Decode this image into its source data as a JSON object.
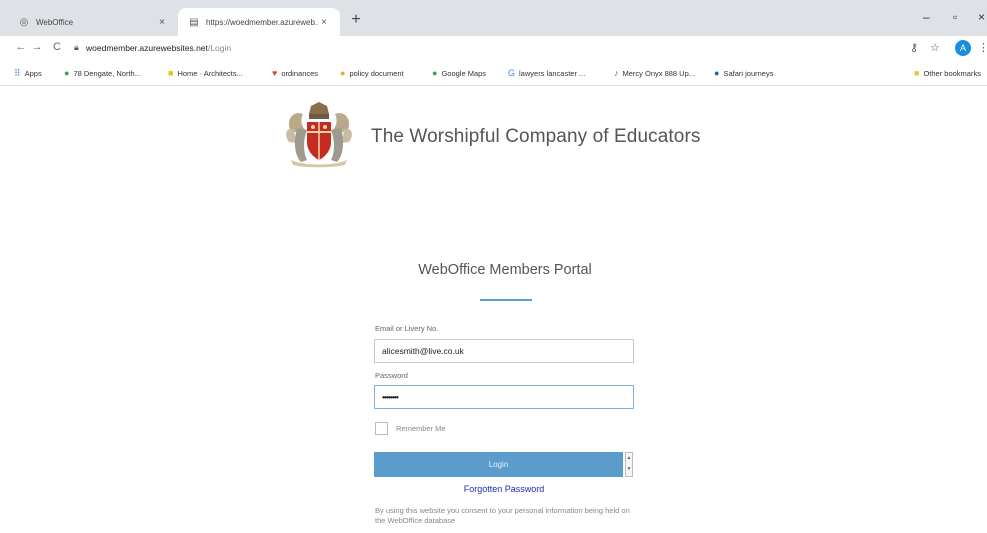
{
  "browser": {
    "tabs": [
      {
        "title": "WebOffice",
        "close": "×"
      },
      {
        "title": "https://woedmember.azureweb...",
        "close": "×"
      }
    ],
    "new_tab": "+",
    "window": {
      "minimize": "–",
      "maximize": "▫",
      "close": "×"
    },
    "nav": {
      "back": "←",
      "forward": "→",
      "reload": "C"
    },
    "address": {
      "host": "woedmember.azurewebsites.net",
      "path": "/Login"
    },
    "profile_initial": "A",
    "bookmarks": [
      {
        "label": "Apps",
        "icon": "apps-grid-icon",
        "glyph": "⠿",
        "color": "#4a7fd0"
      },
      {
        "label": "78 Dengate, North...",
        "icon": "maps-pin-icon",
        "glyph": "●",
        "color": "#34a853"
      },
      {
        "label": "Home · Architects...",
        "icon": "architects-icon",
        "glyph": "■",
        "color": "#e6c21a"
      },
      {
        "label": "ordinances",
        "icon": "heart-icon",
        "glyph": "♥",
        "color": "#d84a2a"
      },
      {
        "label": "policy document",
        "icon": "policy-icon",
        "glyph": "●",
        "color": "#f2a62a"
      },
      {
        "label": "Google Maps",
        "icon": "maps-pin-icon",
        "glyph": "●",
        "color": "#34a853"
      },
      {
        "label": "lawyers lancaster ...",
        "icon": "google-icon",
        "glyph": "G",
        "color": "#4285f4"
      },
      {
        "label": "Mercy Onyx 888 Up...",
        "icon": "mercy-icon",
        "glyph": "♪",
        "color": "#7a4bbf"
      },
      {
        "label": "Safari journeys",
        "icon": "safari-icon",
        "glyph": "●",
        "color": "#2a5fb0"
      },
      {
        "label": "Other bookmarks",
        "icon": "folder-icon",
        "glyph": "■",
        "color": "#f0c24a"
      }
    ]
  },
  "page": {
    "org_name": "The Worshipful Company of Educators",
    "portal_title": "WebOffice Members Portal",
    "email_label": "Email or Livery No.",
    "email_value": "alicesmith@live.co.uk",
    "password_label": "Password",
    "password_value": "••••••••",
    "remember_label": "Remember Me",
    "login_label": "Login",
    "forgot_label": "Forgotten Password",
    "consent_text": "By using this website you consent to your personal information being held on the WebOffice database",
    "colors": {
      "accent": "#5b9ccc",
      "link": "#1d2fb8"
    }
  }
}
